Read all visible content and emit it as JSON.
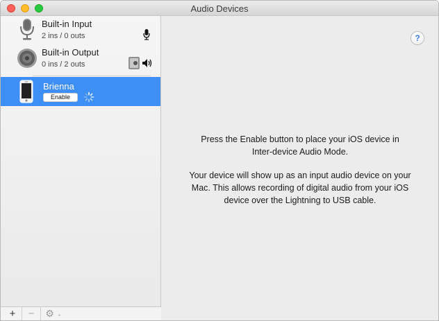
{
  "window": {
    "title": "Audio Devices"
  },
  "devices": [
    {
      "name": "Built-in Input",
      "io": "2 ins / 0 outs",
      "icon": "microphone-icon",
      "status_icon": "microphone-icon"
    },
    {
      "name": "Built-in Output",
      "io": "0 ins / 2 outs",
      "icon": "speaker-icon",
      "status_icon": "speaker-volume-icon"
    },
    {
      "name": "Brienna",
      "icon": "iphone-icon",
      "enable_label": "Enable",
      "selected": true
    }
  ],
  "toolbar": {
    "add": "+",
    "remove": "−",
    "gear": "⚙",
    "gear_icon": "gear-icon"
  },
  "main": {
    "help": "?",
    "message1_line1": "Press the Enable button to place your iOS device in",
    "message1_line2": "Inter-device Audio Mode.",
    "message2_line1": "Your device will show up as an input audio device on your",
    "message2_line2": "Mac. This allows recording of digital audio from your iOS",
    "message2_line3": "device over the Lightning to USB cable."
  },
  "colors": {
    "selection": "#3d8ef5",
    "help_accent": "#3d7ee6"
  }
}
